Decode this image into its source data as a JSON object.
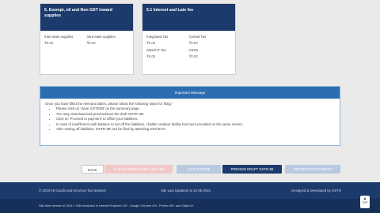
{
  "cards": [
    {
      "title": "5. Exempt, nil and Non GST inward supplies",
      "rows": [
        [
          "Inter-state supplies",
          "Intra-state supplies"
        ],
        [
          "₹0.00",
          "₹0.00"
        ]
      ]
    },
    {
      "title": "5.1 Interest and Late fee",
      "rows": [
        [
          "Integrated Tax",
          "Central Tax"
        ],
        [
          "₹0.00",
          "₹0.00"
        ],
        [
          "State/UT Tax",
          "CESS"
        ],
        [
          "₹0.00",
          "₹0.00"
        ]
      ]
    }
  ],
  "message": {
    "heading": "Important Message",
    "intro": "Once you have filled the relevant tables, please follow the following steps for filing:-",
    "steps": [
      "Please click on 'Save GSTR3B' on the summary page.",
      "You may download and preview/save the draft GSTR-3B.",
      "Click on 'Proceed to payment' to offset your liabilities.",
      "In case of insufficient cash balance to set off the liabilities, challan creation facility has been provided on the same screen.",
      "After setting off liabilities, GSTR-3B can be filed by attaching DSC/EVC."
    ]
  },
  "buttons": {
    "back": "BACK",
    "system_computed": "SYSTEM GENERATED GSTR-3B",
    "save": "SAVE GSTR3B",
    "preview": "PREVIEW DRAFT GSTR-3B",
    "proceed": "PROCEED TO PAYMENT"
  },
  "footer": {
    "copyright": "© 2018-19 Goods and Services Tax Network",
    "updated": "Site Last Updated on 21-05-2021",
    "designed": "Designed & Developed by GSTN",
    "best_viewed": "Site best viewed at 1024 x 768 resolution in Internet Explorer 10+, Google Chrome 49+, Firefox 45+ and Safari 6+"
  },
  "top_button": {
    "label": "TOP"
  },
  "colors": {
    "navy": "#1c3a6b",
    "message_header": "#2b6db0"
  }
}
